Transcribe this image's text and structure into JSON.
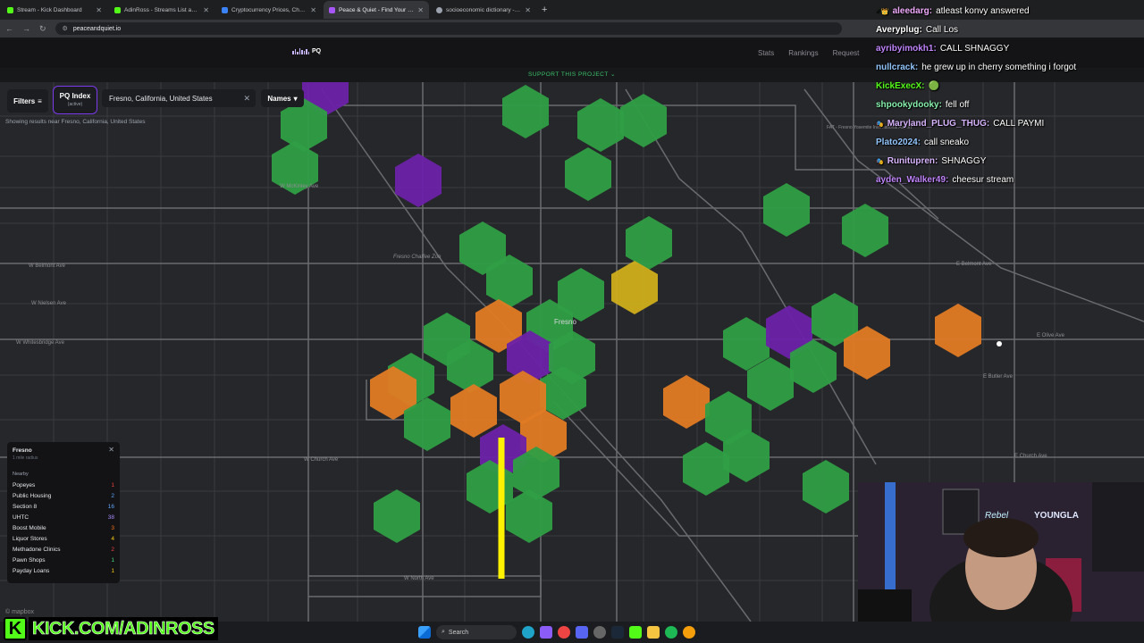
{
  "browser": {
    "tabs": [
      {
        "title": "Stream - Kick Dashboard",
        "color": "#53fc18"
      },
      {
        "title": "AdinRoss - Streams List and Sta",
        "color": "#53fc18"
      },
      {
        "title": "Cryptocurrency Prices, Charts A",
        "color": "#3b82f6"
      },
      {
        "title": "Peace & Quiet - Find Your Quie",
        "color": "#a855f7"
      },
      {
        "title": "socioeconomic dictionary - Go",
        "color": "#9ca3af"
      }
    ],
    "url": "peaceandquiet.io"
  },
  "site": {
    "logo_text": "PQ",
    "nav": [
      "Stats",
      "Rankings",
      "Request"
    ],
    "support_banner": "SUPPORT THIS PROJECT ⌄"
  },
  "controls": {
    "filters_label": "Filters",
    "pq_index_label": "PQ Index",
    "pq_index_sub": "(active)",
    "search_value": "Fresno, California, United States",
    "names_label": "Names",
    "showing_text": "Showing results near Fresno, California, United States"
  },
  "map": {
    "city_label": "Fresno",
    "street_labels": [
      {
        "text": "W McKinley Ave"
      },
      {
        "text": "W Belmont Ave"
      },
      {
        "text": "W Nielsen Ave"
      },
      {
        "text": "W Whitesbridge Ave"
      },
      {
        "text": "W Church Ave"
      },
      {
        "text": "W North Ave"
      },
      {
        "text": "E Belmont Ave"
      },
      {
        "text": "E Church Ave"
      },
      {
        "text": "E Butler Ave"
      },
      {
        "text": "E Olive Ave"
      },
      {
        "text": "Fresno Chaffee Zoo"
      },
      {
        "text": "FAT - Fresno Yosemite International Airport"
      }
    ],
    "colors": {
      "green": "#2f9e44",
      "purple": "#6b21a8",
      "orange": "#e07b24",
      "yellow": "#cfae1b",
      "line": "#fff200"
    }
  },
  "info_card": {
    "title": "Fresno",
    "radius": "1 mile radius",
    "nearby_label": "Nearby",
    "rows": [
      {
        "label": "Popeyes",
        "value": "1",
        "color": "#ef4444"
      },
      {
        "label": "Public Housing",
        "value": "2",
        "color": "#60a5fa"
      },
      {
        "label": "Section 8",
        "value": "16",
        "color": "#60a5fa"
      },
      {
        "label": "UHTC",
        "value": "38",
        "color": "#a78bfa"
      },
      {
        "label": "Boost Mobile",
        "value": "3",
        "color": "#f97316"
      },
      {
        "label": "Liquor Stores",
        "value": "4",
        "color": "#facc15"
      },
      {
        "label": "Methadone Clinics",
        "value": "2",
        "color": "#ef4444"
      },
      {
        "label": "Pawn Shops",
        "value": "1",
        "color": "#4ade80"
      },
      {
        "label": "Payday Loans",
        "value": "1",
        "color": "#facc15"
      }
    ],
    "attribution": "© mapbox"
  },
  "chat": [
    {
      "user": "aleedarg:",
      "text": "atleast konvy answered",
      "color": "#f0abfc",
      "badge": "✓👑"
    },
    {
      "user": "Averyplug:",
      "text": "Call Los",
      "color": "#ffffff",
      "badge": ""
    },
    {
      "user": "ayribyimokh1:",
      "text": "CALL SHNAGGY",
      "color": "#c084fc",
      "badge": ""
    },
    {
      "user": "nullcrack:",
      "text": "he grew up in cherry something i forgot",
      "color": "#93c5fd",
      "badge": ""
    },
    {
      "user": "KickExecX:",
      "text": "🟢",
      "color": "#53fc18",
      "badge": ""
    },
    {
      "user": "shpookydooky:",
      "text": "fell off",
      "color": "#86efac",
      "badge": ""
    },
    {
      "user": "Maryland_PLUG_THUG:",
      "text": "CALL PAYMI",
      "color": "#d8b4fe",
      "badge": "🎭"
    },
    {
      "user": "Plato2024:",
      "text": "call sneako",
      "color": "#93c5fd",
      "badge": ""
    },
    {
      "user": "Runitupren:",
      "text": "SHNAGGY",
      "color": "#d8b4fe",
      "badge": "🎭"
    },
    {
      "user": "ayden_Walker49:",
      "text": "cheesur stream",
      "color": "#c084fc",
      "badge": ""
    }
  ],
  "taskbar": {
    "search_label": "Search"
  },
  "stream": {
    "kick_url": "KICK.COM/ADINROSS",
    "kick_logo": "K"
  }
}
